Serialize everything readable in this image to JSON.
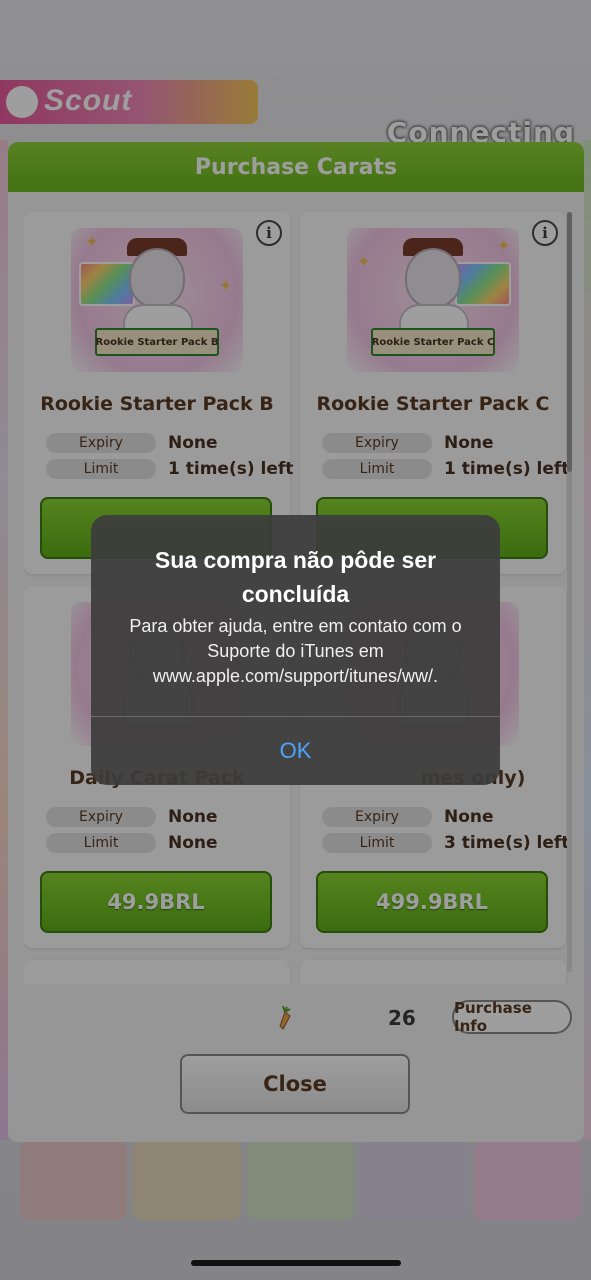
{
  "background": {
    "scout_label": "Scout",
    "status_text": "Connecting"
  },
  "dialog": {
    "title": "Purchase Carats",
    "cards": [
      {
        "image_label": "Rookie Starter Pack B",
        "name": "Rookie Starter Pack B",
        "expiry_key": "Expiry",
        "expiry_value": "None",
        "limit_key": "Limit",
        "limit_value": "1 time(s) left",
        "price": ""
      },
      {
        "image_label": "Rookie Starter Pack C",
        "name": "Rookie Starter Pack C",
        "expiry_key": "Expiry",
        "expiry_value": "None",
        "limit_key": "Limit",
        "limit_value": "1 time(s) left",
        "price": ""
      },
      {
        "name": "Daily Carat Pack",
        "expiry_key": "Expiry",
        "expiry_value": "None",
        "limit_key": "Limit",
        "limit_value": "None",
        "price": "49.9BRL"
      },
      {
        "name": "mes only)",
        "expiry_key": "Expiry",
        "expiry_value": "None",
        "limit_key": "Limit",
        "limit_value": "3 time(s) left",
        "price": "499.9BRL"
      }
    ],
    "carat_count": "26",
    "purchase_info_label": "Purchase Info",
    "close_label": "Close"
  },
  "alert": {
    "title": "Sua compra não pôde ser concluída",
    "message": "Para obter ajuda, entre em contato com o Suporte do iTunes em www.apple.com/support/itunes/ww/.",
    "ok_label": "OK"
  },
  "colors": {
    "header_green": "#7cc52b",
    "button_green": "#6bb81f",
    "alert_bg": "#3c3c3c",
    "alert_link": "#4ea3ff",
    "text_brown": "#5a3a22"
  },
  "icons": [
    "info-icon",
    "carrot-icon",
    "sparkle-icon"
  ]
}
